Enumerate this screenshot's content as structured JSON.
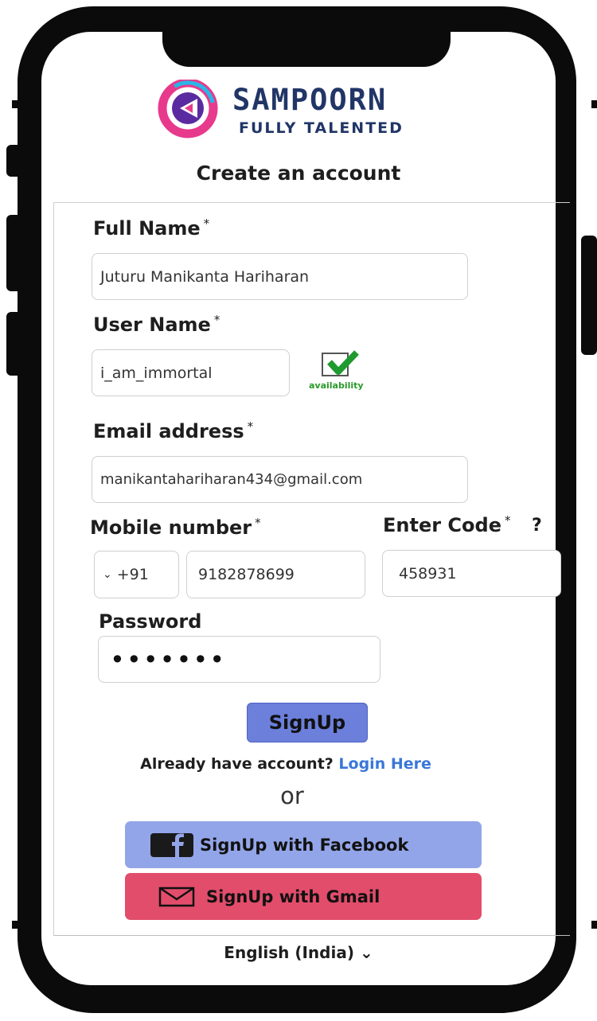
{
  "brand": {
    "name": "SAMPOORN",
    "tagline": "FULLY TALENTED"
  },
  "page_title": "Create an account",
  "full_name": {
    "label": "Full Name",
    "required_mark": "*",
    "value": "Juturu Manikanta Hariharan"
  },
  "user_name": {
    "label": "User Name",
    "required_mark": "*",
    "value": "i_am_immortal",
    "availability_text": "availability"
  },
  "email": {
    "label": "Email address",
    "required_mark": "*",
    "value": "manikantahariharan434@gmail.com"
  },
  "mobile": {
    "label": "Mobile number",
    "required_mark": "*",
    "country_code": "+91",
    "value": "9182878699"
  },
  "code": {
    "label": "Enter Code",
    "required_mark": "*",
    "help": "?",
    "value": "458931"
  },
  "password": {
    "label": "Password",
    "value": "•••••••"
  },
  "signup_button": "SignUp",
  "login_prompt": {
    "text": "Already have account?",
    "link": "Login Here"
  },
  "or_text": "or",
  "facebook_button": "SignUp with Facebook",
  "gmail_button": "SignUp with Gmail",
  "language": {
    "label": "English (India)"
  },
  "colors": {
    "primary_button": "#6b7fdb",
    "facebook": "#93a5e9",
    "gmail": "#e24d6b",
    "link": "#3a77d9",
    "available": "#2a9a2a"
  }
}
